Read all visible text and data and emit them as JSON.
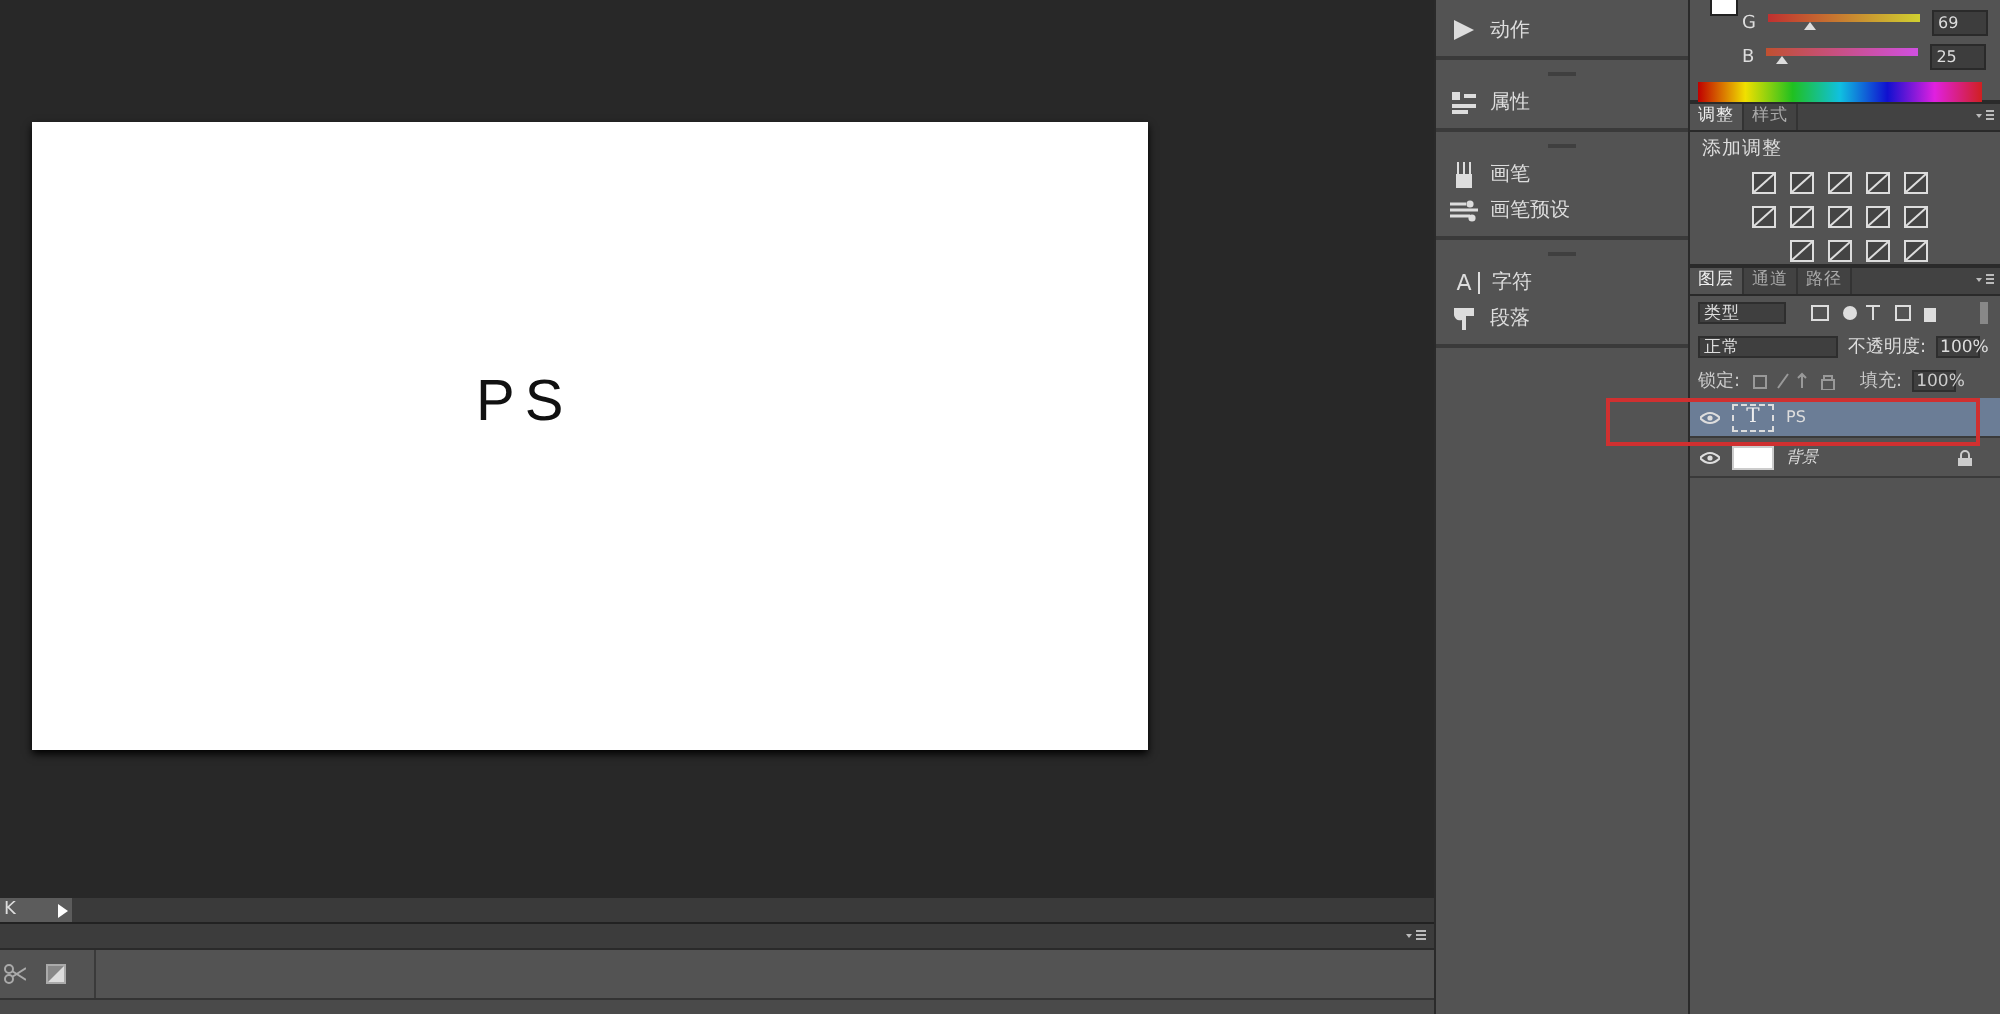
{
  "document": {
    "text": "PS"
  },
  "status_bar": {
    "zoom": "K"
  },
  "panel_dock": {
    "groups": [
      [
        {
          "label": "动作"
        }
      ],
      [
        {
          "label": "属性"
        }
      ],
      [
        {
          "label": "画笔"
        },
        {
          "label": "画笔预设"
        }
      ],
      [
        {
          "label": "字符",
          "glyph": "A"
        },
        {
          "label": "段落"
        }
      ]
    ]
  },
  "color_panel": {
    "channels": [
      {
        "label": "G",
        "value": "69",
        "level": 0.27
      },
      {
        "label": "B",
        "value": "25",
        "level": 0.1
      }
    ]
  },
  "adjustments": {
    "tabs": [
      {
        "label": "调整",
        "selected": true
      },
      {
        "label": "样式",
        "selected": false
      }
    ],
    "heading": "添加调整"
  },
  "layers": {
    "tabs": [
      {
        "label": "图层",
        "selected": true
      },
      {
        "label": "通道",
        "selected": false
      },
      {
        "label": "路径",
        "selected": false
      }
    ],
    "filter": "类型",
    "blend_mode": "正常",
    "opacity_label": "不透明度:",
    "opacity": "100%",
    "lock_label": "锁定:",
    "fill_label": "填充:",
    "fill": "100%",
    "items": [
      {
        "name": "PS",
        "kind": "text",
        "glyph": "T",
        "selected": true,
        "visible": true,
        "locked": false,
        "highlighted": true
      },
      {
        "name": "背景",
        "kind": "fill",
        "selected": false,
        "visible": true,
        "locked": true,
        "highlighted": false
      }
    ]
  }
}
